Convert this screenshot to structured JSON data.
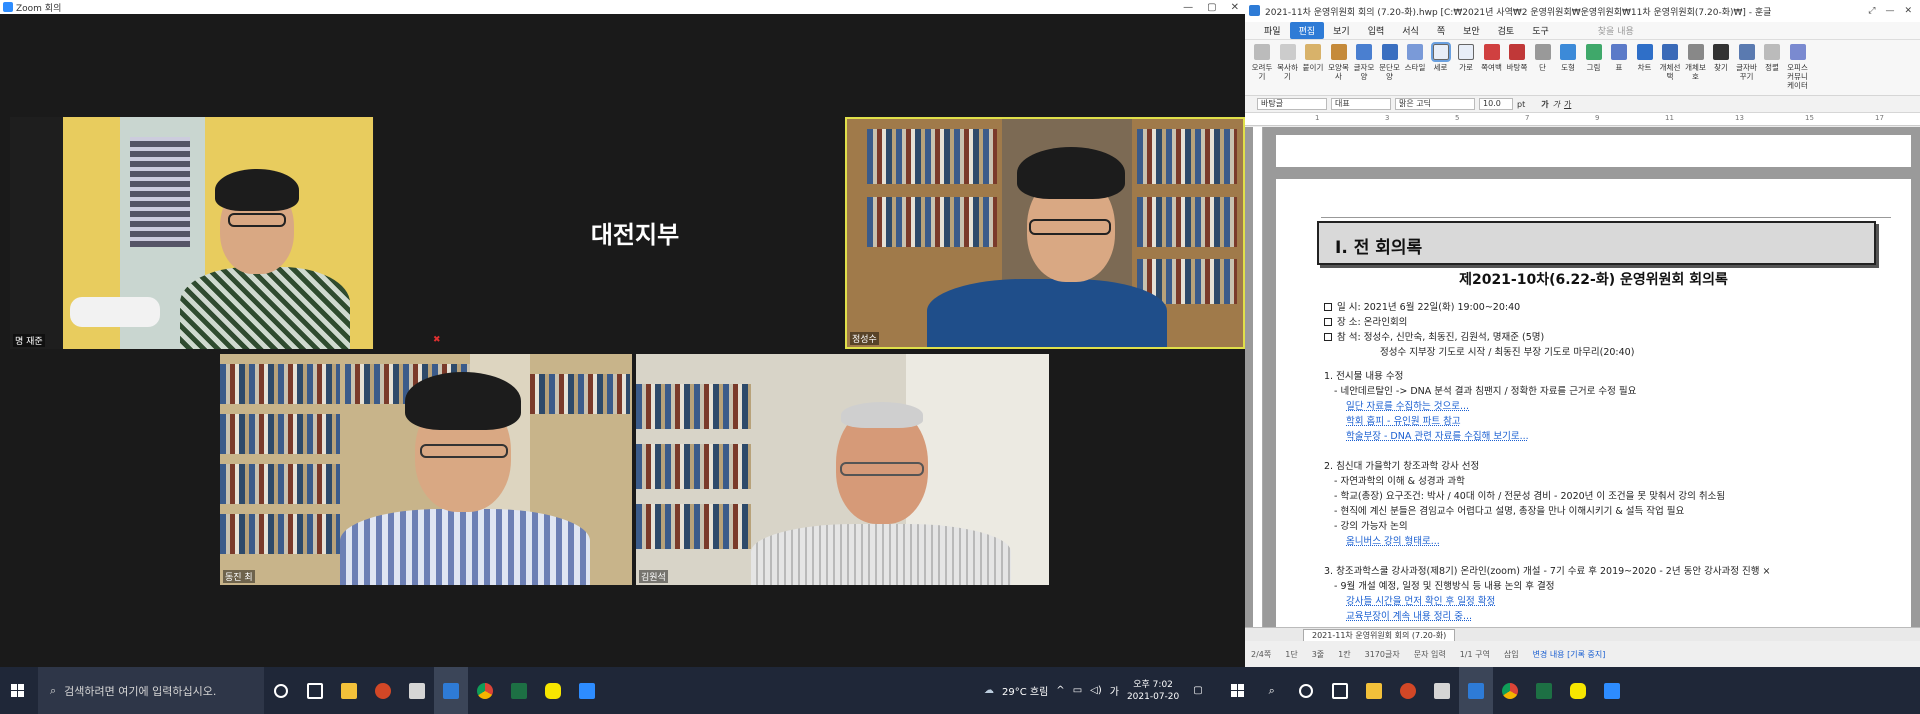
{
  "zoom": {
    "title": "Zoom 회의",
    "participants": [
      {
        "name": "명 재준"
      },
      {
        "name": "대전지부",
        "display_text": "대전지부"
      },
      {
        "name": "정성수"
      },
      {
        "name": "동진 최"
      },
      {
        "name": "김원석"
      }
    ]
  },
  "hwp": {
    "title": "2021-11차 운영위원회 회의 (7.20-화).hwp [C:₩2021년 사역₩2 운영위원회₩운영위원회₩11차 운영위원회(7.20-화)₩] - 훈글",
    "menu": [
      "파일",
      "편집",
      "보기",
      "입력",
      "서식",
      "쪽",
      "보안",
      "검토",
      "도구"
    ],
    "active_menu": "편집",
    "search_placeholder": "찾을 내용",
    "ribbon": [
      "오려두기",
      "복사하기",
      "붙이기",
      "모양복사",
      "글자모양",
      "문단모양",
      "스타일",
      "세로",
      "가로",
      "쪽여백",
      "바탕쪽",
      "단",
      "도형",
      "그림",
      "표",
      "차트",
      "개체선택",
      "개체보호",
      "찾기",
      "글자바꾸기",
      "정렬",
      "오피스커뮤니케이터"
    ],
    "format_bar": {
      "style": "바탕글",
      "para": "대표",
      "font": "맑은 고딕",
      "size": "10.0",
      "unit": "pt"
    },
    "document": {
      "heading": "Ⅰ. 전 회의록",
      "title": "제2021-10차(6.22-화) 운영위원회 회의록",
      "info": [
        "일 시: 2021년 6월 22일(화) 19:00~20:40",
        "장 소: 온라인회의",
        "참 석: 정성수, 신만숙, 최동진, 김원석, 명재준 (5명)"
      ],
      "prayer": "정성수 지부장 기도로 시작 / 최동진 부장 기도로 마무리(20:40)",
      "items": [
        {
          "text": "1. 전시물 내용 수정",
          "color": "black"
        },
        {
          "text": "- 네안데르탈인 -> DNA 분석 결과 침팬지 / 정확한 자료를 근거로 수정 필요",
          "color": "black"
        },
        {
          "text": "일단 자료를 수집하는 것으로...",
          "color": "blue"
        },
        {
          "text": "학회 홈피 - 유인원 파트 참고",
          "color": "blue"
        },
        {
          "text": "학술부장 - DNA 관련 자료를 수집해 보기로...",
          "color": "blue"
        },
        {
          "text": "2. 침신대 가을학기 창조과학 강사 선정",
          "color": "black"
        },
        {
          "text": "- 자연과학의 이해 & 성경과 과학",
          "color": "black"
        },
        {
          "text": "- 학교(총장) 요구조건: 박사 / 40대 이하 / 전문성 겸비 - 2020년 이 조건을 못 맞춰서 강의 취소됨",
          "color": "black"
        },
        {
          "text": "- 현직에 계신 분들은 겸임교수 어렵다고 설명, 총장을 만나 이해시키기 & 설득 작업 필요",
          "color": "black"
        },
        {
          "text": "- 강의 가능자 논의",
          "color": "black"
        },
        {
          "text": "옴니버스 강의 형태로...",
          "color": "blue"
        },
        {
          "text": "3. 창조과학스쿨 강사과정(제8기) 온라인(zoom) 개설 - 7기 수료 후 2019~2020 - 2년 동안 강사과정 진행 ×",
          "color": "black"
        },
        {
          "text": "- 9월 개설 예정, 일정 및 진행방식 등 내용 논의 후 결정",
          "color": "black"
        },
        {
          "text": "강사들 시간을 먼저 확인 후 일정 확정",
          "color": "blue"
        },
        {
          "text": "교육부장이 계속 내용 정리 중...",
          "color": "blue"
        }
      ]
    },
    "tab": "2021-11차 운영위원회 회의 (7.20-화)",
    "status": [
      "2/4쪽",
      "1단",
      "3줄",
      "1칸",
      "3170글자",
      "문자 입력",
      "1/1 구역",
      "삽입",
      "변경 내용 [기록 중지]"
    ]
  },
  "taskbar": {
    "search_placeholder": "검색하려면 여기에 입력하십시오.",
    "weather": "29°C 흐림",
    "time": "오후 7:02",
    "date": "2021-07-20",
    "lang": "가"
  }
}
